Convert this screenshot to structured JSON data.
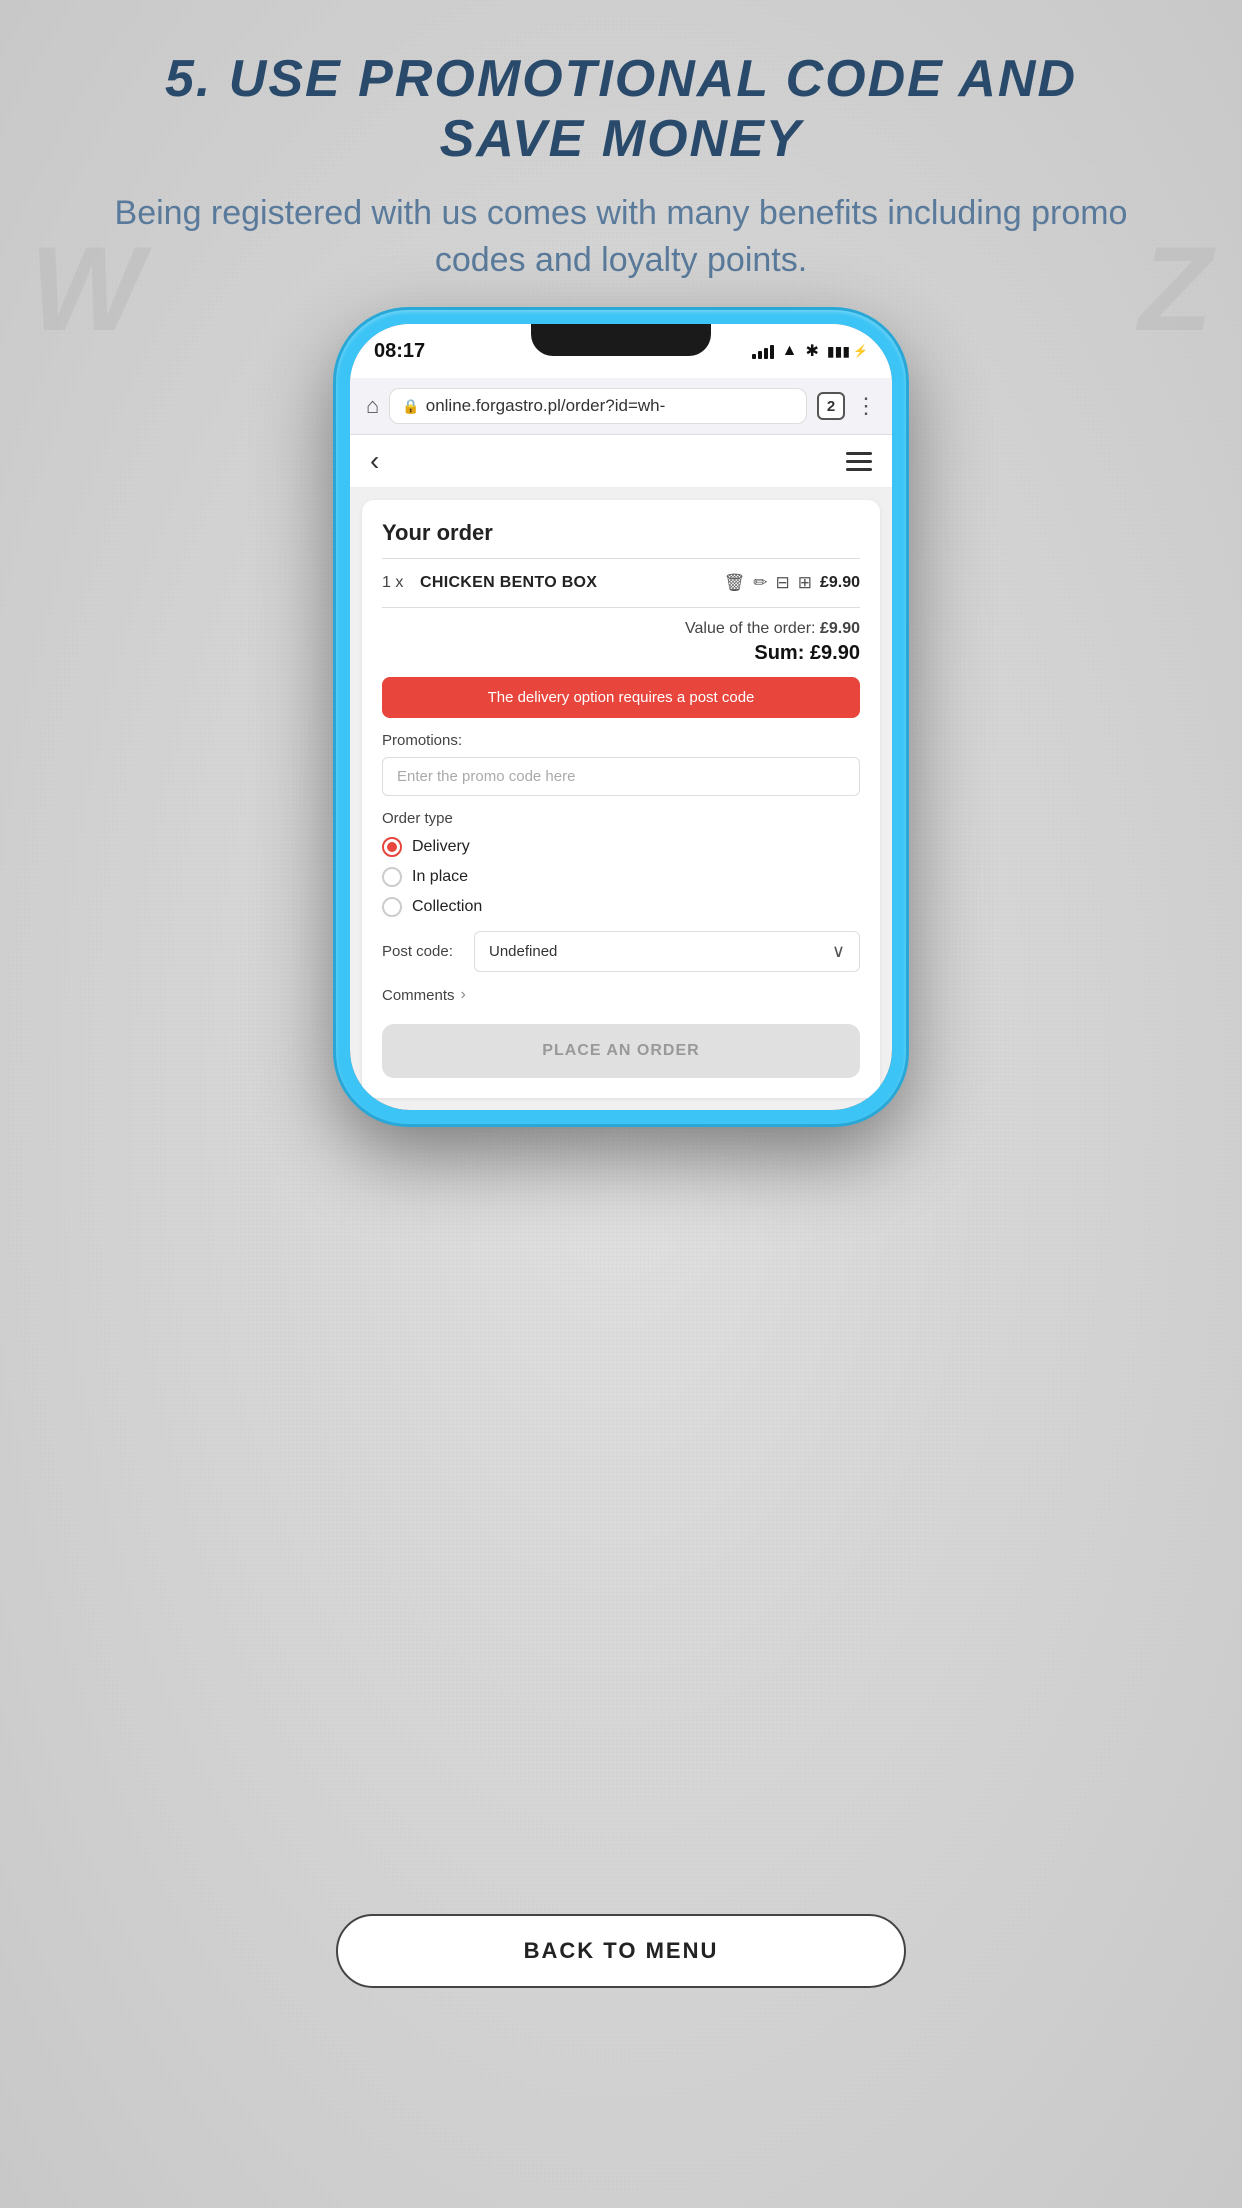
{
  "page": {
    "title_line1": "5. USE PROMOTIONAL CODE AND",
    "title_line2": "SAVE MONEY",
    "subtitle": "Being registered with us comes with many benefits including promo codes and  loyalty points.",
    "bg_letter_left": "W",
    "bg_letter_right": "Z"
  },
  "phone": {
    "status": {
      "time": "08:17",
      "bluetooth": "✱",
      "battery": "🔋"
    },
    "browser": {
      "address": "online.forgastro.pl/order?id=wh-",
      "tab_count": "2"
    }
  },
  "app": {
    "order_title": "Your order",
    "order_item": {
      "qty": "1 x",
      "name": "CHICKEN BENTO BOX",
      "price": "£9.90"
    },
    "summary": {
      "value_label": "Value of the order:",
      "value": "£9.90",
      "sum_label": "Sum:",
      "sum": "£9.90"
    },
    "delivery_warning": "The delivery option requires a post code",
    "promotions_label": "Promotions:",
    "promo_placeholder": "Enter the promo code here",
    "order_type_label": "Order type",
    "order_types": [
      {
        "label": "Delivery",
        "selected": true
      },
      {
        "label": "In place",
        "selected": false
      },
      {
        "label": "Collection",
        "selected": false
      }
    ],
    "postcode_label": "Post code:",
    "postcode_value": "Undefined",
    "comments_label": "Comments",
    "place_order_label": "PLACE AN ORDER"
  },
  "back_to_menu": {
    "label": "BACK TO MENU"
  }
}
